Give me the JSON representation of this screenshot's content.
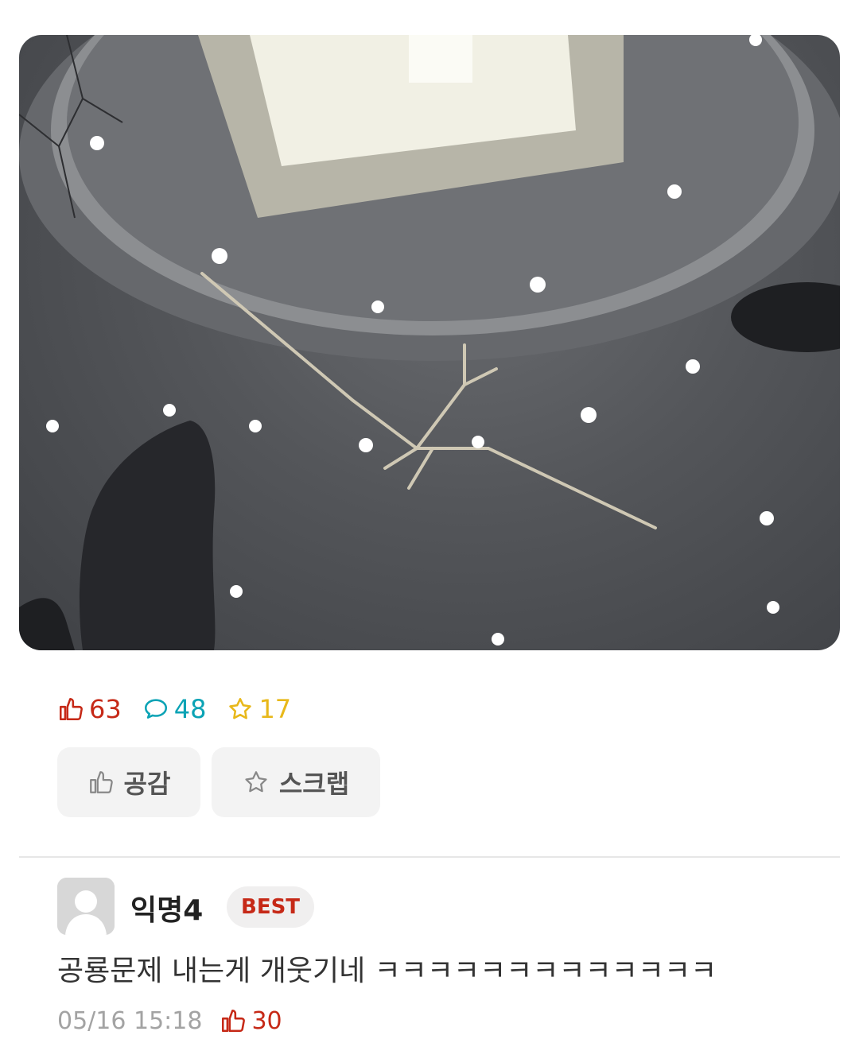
{
  "post": {
    "image_alt_icon": "photo",
    "stats": {
      "likes": "63",
      "comments": "48",
      "scraps": "17"
    },
    "actions": {
      "empathy_label": "공감",
      "scrap_label": "스크랩"
    }
  },
  "comment": {
    "author": "익명4",
    "badge": "BEST",
    "text": "공룡문제 내는게 개웃기네 ㅋㅋㅋㅋㅋㅋㅋㅋㅋㅋㅋㅋㅋ",
    "timestamp": "05/16 15:18",
    "likes": "30"
  },
  "colors": {
    "like_red": "#c62917",
    "comment_teal": "#0ba3b5",
    "scrap_yellow": "#e8b81a",
    "muted_gray": "#a3a3a3"
  }
}
